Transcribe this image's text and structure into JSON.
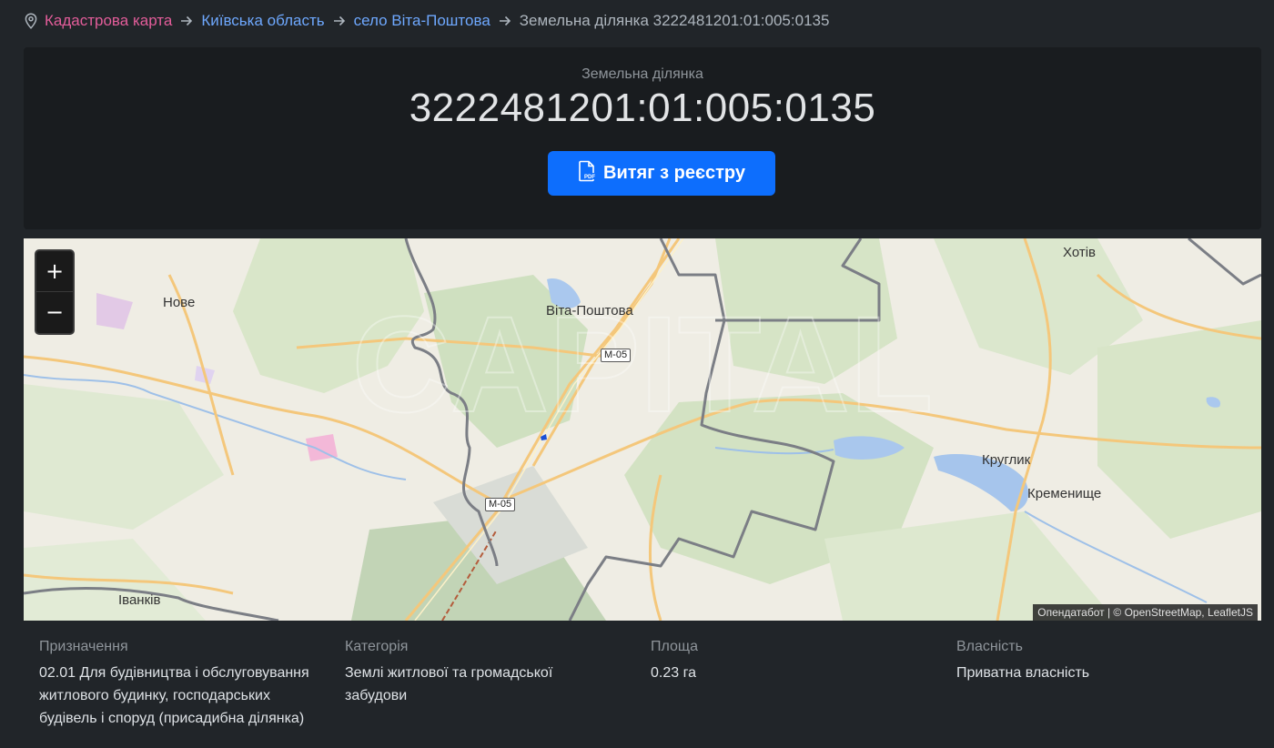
{
  "breadcrumb": {
    "root": "Кадастрова карта",
    "region": "Київська область",
    "village": "село Віта-Поштова",
    "current": "Земельна ділянка 3222481201:01:005:0135"
  },
  "hero": {
    "label": "Земельна ділянка",
    "cadastral_number": "3222481201:01:005:0135",
    "extract_button": "Витяг з реєстру"
  },
  "map": {
    "zoom_in": "+",
    "zoom_out": "−",
    "attribution": "Опендатабот | © OpenStreetMap, LeafletJS",
    "places": {
      "vita": "Віта-Поштова",
      "nove": "Нове",
      "khotiv": "Хотів",
      "kruhlyk": "Круглик",
      "kremenyshche": "Кременище",
      "ivankiv": "Іванків"
    },
    "roads": {
      "m05_a": "М-05",
      "m05_b": "М-05"
    }
  },
  "details": {
    "purpose": {
      "label": "Призначення",
      "value": "02.01 Для будівництва і обслуговування житлового будинку, господарських будівель і споруд (присадибна ділянка)"
    },
    "category": {
      "label": "Категорія",
      "value": "Землі житлової та громадської забудови"
    },
    "area": {
      "label": "Площа",
      "value": "0.23 га"
    },
    "ownership": {
      "label": "Власність",
      "value": "Приватна власність"
    }
  },
  "colors": {
    "background": "#212529",
    "panel": "#191c1f",
    "accent": "#0d6efd",
    "crumb_root": "#e35d9a",
    "crumb_link": "#6ea8fe"
  }
}
